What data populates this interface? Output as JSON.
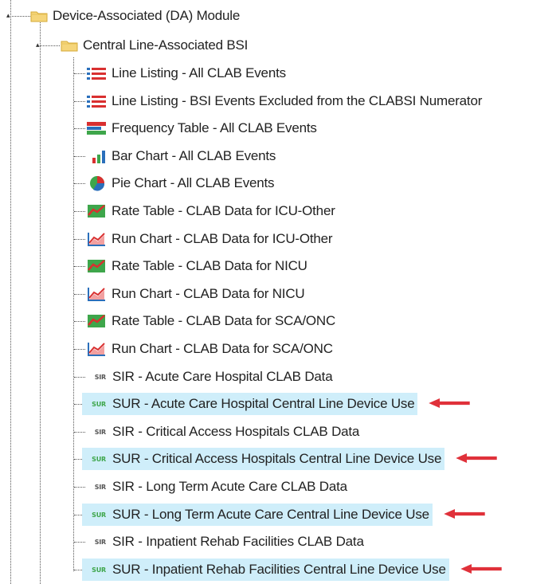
{
  "colors": {
    "highlight": "#cfeefa",
    "arrow": "#e0313a",
    "folder": "#f5d57a",
    "sur_text": "#3ea64b",
    "sir_text": "#555555"
  },
  "tree": {
    "root": {
      "label": "Device-Associated (DA) Module",
      "icon": "folder-icon"
    },
    "subfolder": {
      "label": "Central Line-Associated BSI",
      "icon": "folder-icon"
    },
    "items": [
      {
        "label": "Line Listing - All CLAB Events",
        "icon": "line-listing-icon"
      },
      {
        "label": "Line Listing - BSI Events Excluded from the CLABSI Numerator",
        "icon": "line-listing-icon"
      },
      {
        "label": "Frequency Table - All CLAB Events",
        "icon": "frequency-table-icon"
      },
      {
        "label": "Bar Chart - All CLAB Events",
        "icon": "bar-chart-icon"
      },
      {
        "label": "Pie Chart - All CLAB Events",
        "icon": "pie-chart-icon"
      },
      {
        "label": "Rate Table - CLAB Data for ICU-Other",
        "icon": "rate-table-icon"
      },
      {
        "label": "Run Chart - CLAB Data for ICU-Other",
        "icon": "run-chart-icon"
      },
      {
        "label": "Rate Table - CLAB Data for NICU",
        "icon": "rate-table-icon"
      },
      {
        "label": "Run Chart - CLAB Data for NICU",
        "icon": "run-chart-icon"
      },
      {
        "label": "Rate Table - CLAB Data for SCA/ONC",
        "icon": "rate-table-icon"
      },
      {
        "label": "Run Chart - CLAB Data for SCA/ONC",
        "icon": "run-chart-icon"
      },
      {
        "label": "SIR - Acute Care Hospital CLAB Data",
        "icon": "sir-icon",
        "badge": "SIR"
      },
      {
        "label": "SUR - Acute Care Hospital Central Line Device Use",
        "icon": "sur-icon",
        "badge": "SUR",
        "highlighted": true
      },
      {
        "label": "SIR - Critical Access Hospitals CLAB Data",
        "icon": "sir-icon",
        "badge": "SIR"
      },
      {
        "label": "SUR - Critical Access Hospitals Central Line Device Use",
        "icon": "sur-icon",
        "badge": "SUR",
        "highlighted": true
      },
      {
        "label": "SIR - Long Term Acute Care CLAB Data",
        "icon": "sir-icon",
        "badge": "SIR"
      },
      {
        "label": "SUR - Long Term Acute Care Central Line Device Use",
        "icon": "sur-icon",
        "badge": "SUR",
        "highlighted": true
      },
      {
        "label": "SIR - Inpatient Rehab Facilities CLAB Data",
        "icon": "sir-icon",
        "badge": "SIR"
      },
      {
        "label": "SUR - Inpatient Rehab Facilities Central Line Device Use",
        "icon": "sur-icon",
        "badge": "SUR",
        "highlighted": true
      }
    ]
  }
}
